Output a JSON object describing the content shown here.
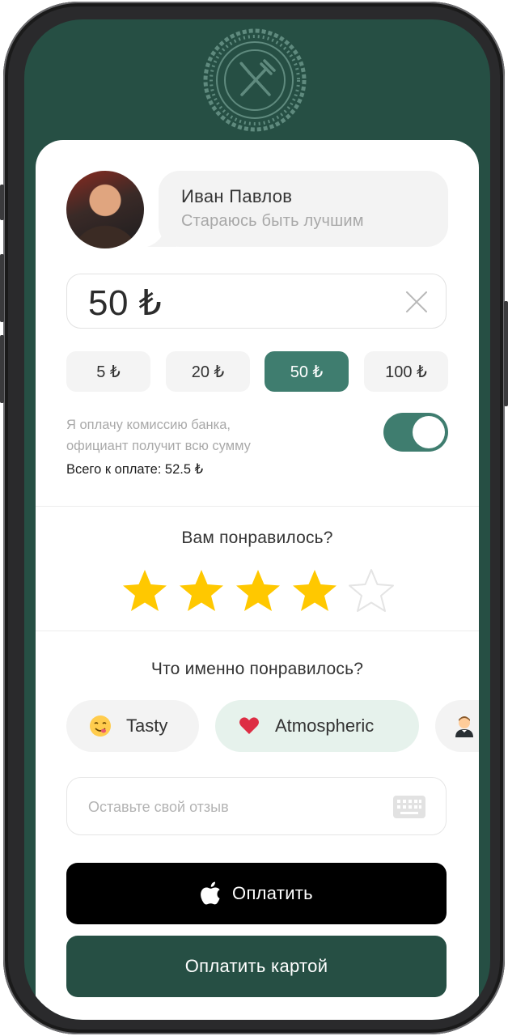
{
  "profile": {
    "name": "Иван Павлов",
    "status": "Стараюсь быть лучшим"
  },
  "tip": {
    "amount": "50 ₺",
    "presets": [
      "5 ₺",
      "20 ₺",
      "50 ₺",
      "100 ₺"
    ],
    "selected_index": 2
  },
  "fee": {
    "text_line1": "Я оплачу комиссию банка,",
    "text_line2": "официант получит всю сумму",
    "toggle_on": true,
    "total": "Всего к оплате: 52.5 ₺"
  },
  "rating": {
    "question": "Вам понравилось?",
    "value": 4,
    "max": 5,
    "star_color": "#ffc800"
  },
  "feedback": {
    "question": "Что именно понравилось?",
    "tags": [
      {
        "label": "Tasty",
        "icon": "yum-face-emoji-icon",
        "selected": false
      },
      {
        "label": "Atmospheric",
        "icon": "heart-emoji-icon",
        "selected": true
      },
      {
        "label": "",
        "icon": "waiter-emoji-icon",
        "selected": false
      }
    ],
    "review_placeholder": "Оставьте свой отзыв"
  },
  "actions": {
    "apple_pay_label": "Оплатить",
    "card_pay_label": "Оплатить картой"
  },
  "colors": {
    "brand": "#264f44",
    "accent": "#3f7d6f",
    "tag_selected_bg": "#e6f2ec"
  }
}
